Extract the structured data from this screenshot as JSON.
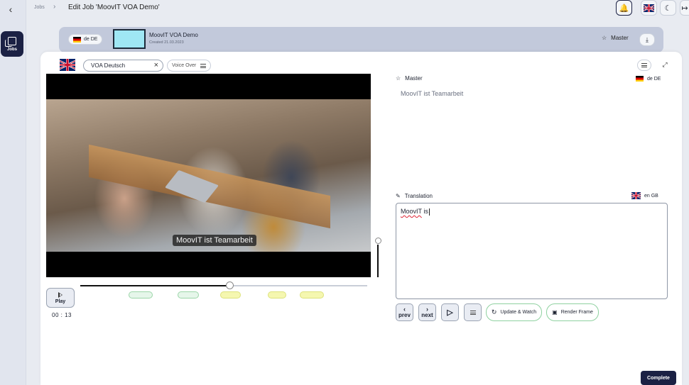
{
  "rail": {
    "jobs_label": "Jobs"
  },
  "header": {
    "breadcrumb": "Jobs",
    "title": "Edit Job 'MoovIT VOA Demo'"
  },
  "job": {
    "language": "de DE",
    "name": "MoovIT VOA Demo",
    "created": "Created 21.03.2023",
    "master_label": "Master"
  },
  "editor": {
    "voa_value": "VOA Deutsch",
    "voiceover_label": "Voice Over",
    "subtitle": "MoovIT ist Teamarbeit",
    "play_label": "Play",
    "timecode": "00 : 13",
    "timeline_progress": 0.52
  },
  "master": {
    "label": "Master",
    "lang": "de DE",
    "text": "MoovIT ist Teamarbeit"
  },
  "translation": {
    "label": "Translation",
    "lang": "en GB",
    "text_underlined": "MoovIT",
    "text_rest": " is"
  },
  "controls": {
    "prev": "prev",
    "next": "next",
    "update_watch": "Update & Watch",
    "render_frame": "Render Frame",
    "complete": "Complete"
  },
  "colors": {
    "accent": "#1b2144",
    "green_segment": "#9bd6a8",
    "yellow_segment": "#dde27c"
  }
}
